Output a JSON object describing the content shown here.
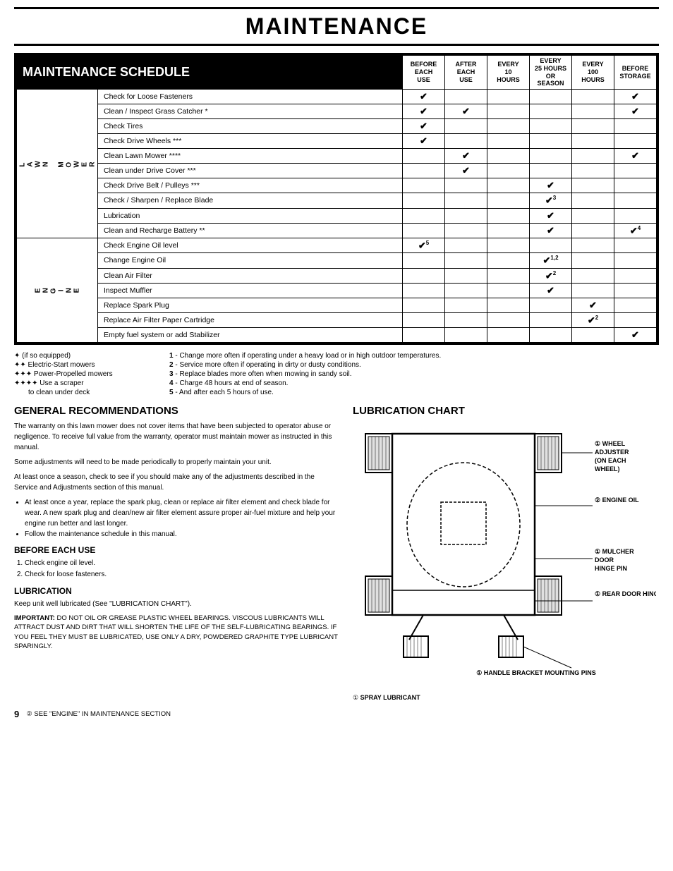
{
  "title": "MAINTENANCE",
  "schedule": {
    "header_label": "MAINTENANCE SCHEDULE",
    "columns": [
      "BEFORE EACH USE",
      "AFTER EACH USE",
      "EVERY 10 HOURS",
      "EVERY 25 HOURS OR SEASON",
      "EVERY 100 HOURS",
      "BEFORE STORAGE"
    ],
    "col_headers_short": [
      {
        "line1": "BEFORE",
        "line2": "EACH",
        "line3": "USE"
      },
      {
        "line1": "AFTER",
        "line2": "EACH",
        "line3": "USE"
      },
      {
        "line1": "EVERY",
        "line2": "10",
        "line3": "HOURS"
      },
      {
        "line1": "EVERY",
        "line2": "25 HOURS",
        "line3": "OR SEASON"
      },
      {
        "line1": "EVERY",
        "line2": "100",
        "line3": "HOURS"
      },
      {
        "line1": "BEFORE",
        "line2": "STORAGE",
        "line3": ""
      }
    ],
    "sections": [
      {
        "label": "LAWN MOWER",
        "label_short": "L\nA\nW\nN\n\nM\nO\nW\nE\nR",
        "rows": [
          {
            "item": "Check for Loose Fasteners",
            "checks": {
              "before_each": "✔",
              "after_each": "",
              "every10": "",
              "every25": "",
              "every100": "",
              "before_storage": "✔"
            }
          },
          {
            "item": "Clean / Inspect Grass Catcher *",
            "checks": {
              "before_each": "✔",
              "after_each": "✔",
              "every10": "",
              "every25": "",
              "every100": "",
              "before_storage": "✔"
            }
          },
          {
            "item": "Check Tires",
            "checks": {
              "before_each": "✔",
              "after_each": "",
              "every10": "",
              "every25": "",
              "every100": "",
              "before_storage": ""
            }
          },
          {
            "item": "Check Drive Wheels ***",
            "checks": {
              "before_each": "✔",
              "after_each": "",
              "every10": "",
              "every25": "",
              "every100": "",
              "before_storage": ""
            }
          },
          {
            "item": "Clean Lawn Mower ****",
            "checks": {
              "before_each": "",
              "after_each": "✔",
              "every10": "",
              "every25": "",
              "every100": "",
              "before_storage": "✔"
            }
          },
          {
            "item": "Clean under Drive Cover ***",
            "checks": {
              "before_each": "",
              "after_each": "✔",
              "every10": "",
              "every25": "",
              "every100": "",
              "before_storage": ""
            }
          },
          {
            "item": "Check Drive Belt / Pulleys ***",
            "checks": {
              "before_each": "",
              "after_each": "",
              "every10": "",
              "every25": "✔",
              "every100": "",
              "before_storage": ""
            }
          },
          {
            "item": "Check / Sharpen / Replace Blade",
            "checks": {
              "before_each": "",
              "after_each": "",
              "every10": "",
              "every25": "✔3",
              "every100": "",
              "before_storage": ""
            }
          },
          {
            "item": "Lubrication",
            "checks": {
              "before_each": "",
              "after_each": "",
              "every10": "",
              "every25": "✔",
              "every100": "",
              "before_storage": ""
            }
          },
          {
            "item": "Clean and Recharge Battery **",
            "checks": {
              "before_each": "",
              "after_each": "",
              "every10": "",
              "every25": "✔",
              "every100": "",
              "before_storage": "✔4"
            }
          }
        ]
      },
      {
        "label": "ENGINE",
        "label_short": "E\nN\nG\nI\nN\nE",
        "rows": [
          {
            "item": "Check Engine Oil level",
            "checks": {
              "before_each": "✔5",
              "after_each": "",
              "every10": "",
              "every25": "",
              "every100": "",
              "before_storage": ""
            }
          },
          {
            "item": "Change Engine Oil",
            "checks": {
              "before_each": "",
              "after_each": "",
              "every10": "",
              "every25": "✔1,2",
              "every100": "",
              "before_storage": ""
            }
          },
          {
            "item": "Clean Air Filter",
            "checks": {
              "before_each": "",
              "after_each": "",
              "every10": "",
              "every25": "✔2",
              "every100": "",
              "before_storage": ""
            }
          },
          {
            "item": "Inspect Muffler",
            "checks": {
              "before_each": "",
              "after_each": "",
              "every10": "",
              "every25": "✔",
              "every100": "",
              "before_storage": ""
            }
          },
          {
            "item": "Replace Spark Plug",
            "checks": {
              "before_each": "",
              "after_each": "",
              "every10": "",
              "every25": "",
              "every100": "✔",
              "before_storage": ""
            }
          },
          {
            "item": "Replace Air Filter Paper Cartridge",
            "checks": {
              "before_each": "",
              "after_each": "",
              "every10": "",
              "every25": "",
              "every100": "✔2",
              "before_storage": ""
            }
          },
          {
            "item": "Empty fuel system or add Stabilizer",
            "checks": {
              "before_each": "",
              "after_each": "",
              "every10": "",
              "every25": "",
              "every100": "",
              "before_storage": "✔"
            }
          }
        ]
      }
    ]
  },
  "footnotes": {
    "left": [
      "✶ (if so equipped)",
      "✶✶ Electric-Start mowers",
      "✶✶✶ Power-Propelled mowers",
      "✶✶✶✶ Use a scraper",
      "     to clean under deck"
    ],
    "right": [
      "1 - Change more often if operating under a heavy load or in high outdoor temperatures.",
      "2 - Service more often if operating in dirty or dusty conditions.",
      "3 - Replace blades more often when mowing in sandy soil.",
      "4 - Charge 48 hours at end of season.",
      "5 - And after each 5 hours of use."
    ]
  },
  "general_recommendations": {
    "heading": "GENERAL RECOMMENDATIONS",
    "paragraphs": [
      "The warranty on this lawn mower does not cover items that have been subjected to operator abuse or negligence. To receive full value from the warranty, operator must maintain mower as instructed in this manual.",
      "Some adjustments will need to be made periodically to properly maintain your unit.",
      "At least once a season, check to see if you should make any of the adjustments described in the Service and Adjustments section of this manual."
    ],
    "bullets": [
      "At least once a year, replace the spark plug, clean or replace air filter element and check blade for wear. A new spark plug and clean/new air filter element assure proper air-fuel mixture and help your engine run better and last longer.",
      "Follow the maintenance schedule in this manual."
    ],
    "before_each_use": {
      "heading": "BEFORE EACH USE",
      "items": [
        "Check engine oil level.",
        "Check for loose fasteners."
      ]
    },
    "lubrication": {
      "heading": "LUBRICATION",
      "text": "Keep unit well lubricated (See \"LUBRICATION CHART\").",
      "important_label": "IMPORTANT:",
      "important_text": "DO NOT OIL OR GREASE PLASTIC WHEEL BEARINGS. VISCOUS LUBRICANTS WILL ATTRACT DUST AND DIRT THAT WILL SHORTEN THE LIFE OF THE SELF-LUBRICATING BEARINGS. IF YOU FEEL THEY MUST BE LUBRICATED, USE ONLY A DRY, POWDERED GRAPHITE TYPE LUBRICANT SPARINGLY."
    }
  },
  "lubrication_chart": {
    "heading": "LUBRICATION CHART",
    "labels": [
      {
        "num": "①",
        "text": "WHEEL ADJUSTER (ON EACH WHEEL)"
      },
      {
        "num": "②",
        "text": "ENGINE OIL"
      },
      {
        "num": "①",
        "text": "MULCHER DOOR HINGE PIN"
      },
      {
        "num": "①",
        "text": "REAR DOOR HINGE"
      },
      {
        "num": "①",
        "text": "HANDLE BRACKET MOUNTING PINS"
      }
    ],
    "bottom_labels": [
      {
        "num": "①",
        "text": "SPRAY LUBRICANT"
      },
      {
        "num": "②",
        "text": "SEE \"ENGINE\" IN MAINTENANCE SECTION"
      }
    ]
  },
  "page_number": "9"
}
